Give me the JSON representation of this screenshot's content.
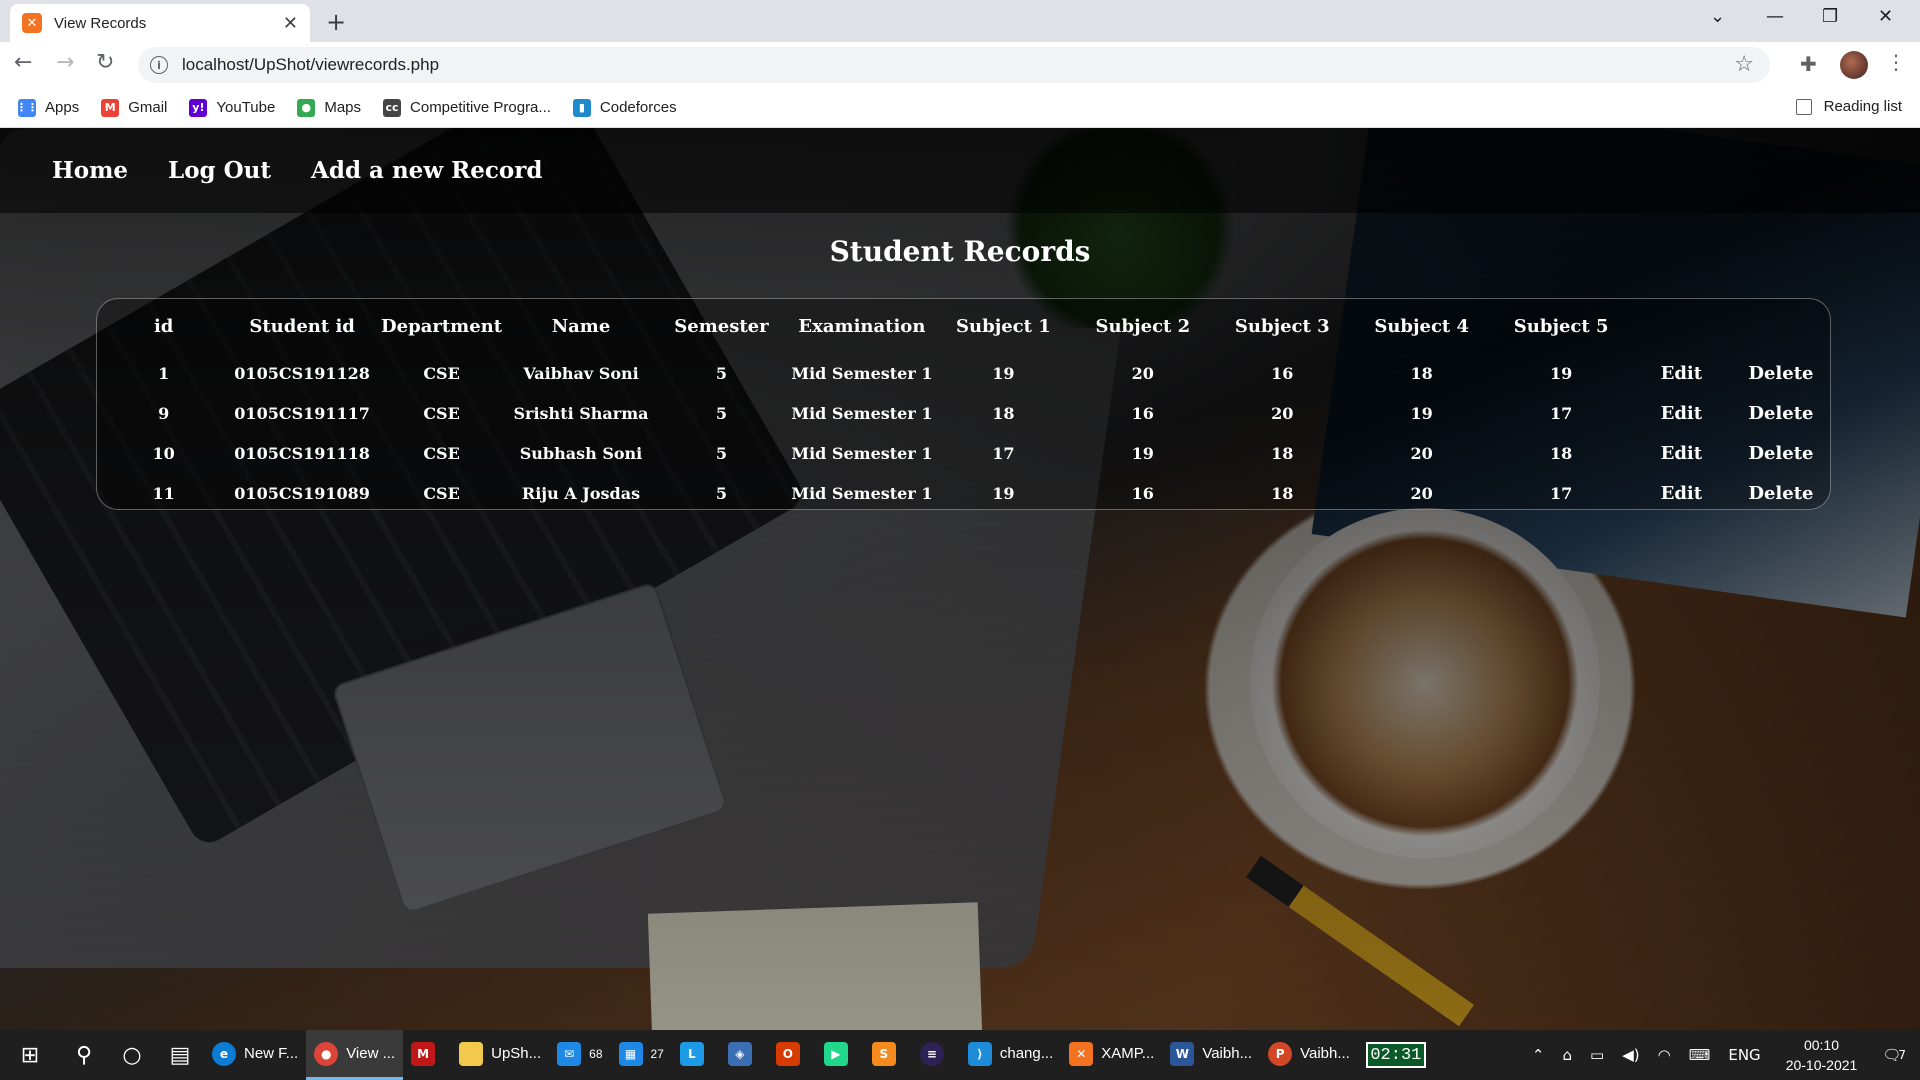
{
  "browser": {
    "tab_title": "View Records",
    "url": "localhost/UpShot/viewrecords.php",
    "bookmarks": [
      {
        "label": "Apps",
        "icon": "apps-grid-icon",
        "color": "#4285f4"
      },
      {
        "label": "Gmail",
        "icon": "gmail-icon",
        "color": "#ea4335"
      },
      {
        "label": "YouTube",
        "icon": "yahoo-icon",
        "color": "#6001d2"
      },
      {
        "label": "Maps",
        "icon": "maps-pin-icon",
        "color": "#34a853"
      },
      {
        "label": "Competitive Progra...",
        "icon": "cc-icon",
        "color": "#444444"
      },
      {
        "label": "Codeforces",
        "icon": "codeforces-icon",
        "color": "#1f8acb"
      }
    ],
    "reading_list": "Reading list"
  },
  "nav": {
    "home": "Home",
    "logout": "Log Out",
    "add": "Add a new Record"
  },
  "title": "Student Records",
  "table": {
    "headers": [
      "id",
      "Student id",
      "Department",
      "Name",
      "Semester",
      "Examination",
      "Subject 1",
      "Subject 2",
      "Subject 3",
      "Subject 4",
      "Subject 5",
      "",
      ""
    ],
    "edit_label": "Edit",
    "delete_label": "Delete",
    "rows": [
      [
        "1",
        "0105CS191128",
        "CSE",
        "Vaibhav Soni",
        "5",
        "Mid Semester 1",
        "19",
        "20",
        "16",
        "18",
        "19"
      ],
      [
        "9",
        "0105CS191117",
        "CSE",
        "Srishti Sharma",
        "5",
        "Mid Semester 1",
        "18",
        "16",
        "20",
        "19",
        "17"
      ],
      [
        "10",
        "0105CS191118",
        "CSE",
        "Subhash Soni",
        "5",
        "Mid Semester 1",
        "17",
        "19",
        "18",
        "20",
        "18"
      ],
      [
        "11",
        "0105CS191089",
        "CSE",
        "Riju A Josdas",
        "5",
        "Mid Semester 1",
        "19",
        "16",
        "18",
        "20",
        "17"
      ]
    ]
  },
  "taskbar": {
    "apps": [
      {
        "label": "New F...",
        "icon": "edge-icon",
        "color": "#0c7cd5",
        "active": false
      },
      {
        "label": "View ...",
        "icon": "chrome-icon",
        "color": "#db4437",
        "active": true
      },
      {
        "label": "",
        "icon": "mcafee-icon",
        "color": "#c01818",
        "active": false
      },
      {
        "label": "UpSh...",
        "icon": "folder-icon",
        "color": "#f2c94c",
        "active": false
      },
      {
        "label": "",
        "icon": "mail-icon",
        "color": "#1e88e5",
        "active": false,
        "badge": "68"
      },
      {
        "label": "",
        "icon": "calendar-icon",
        "color": "#1e88e5",
        "active": false,
        "badge": "27"
      },
      {
        "label": "",
        "icon": "l-app-icon",
        "color": "#1e9be6",
        "active": false
      },
      {
        "label": "",
        "icon": "virtualbox-icon",
        "color": "#3c6eb4",
        "active": false
      },
      {
        "label": "",
        "icon": "office-icon",
        "color": "#d83b01",
        "active": false
      },
      {
        "label": "",
        "icon": "pycharm-icon",
        "color": "#21d789",
        "active": false
      },
      {
        "label": "",
        "icon": "sublime-icon",
        "color": "#f58b1f",
        "active": false
      },
      {
        "label": "",
        "icon": "eclipse-icon",
        "color": "#2c2255",
        "active": false
      },
      {
        "label": "chang...",
        "icon": "vscode-icon",
        "color": "#1e8bd8",
        "active": false
      },
      {
        "label": "XAMP...",
        "icon": "xampp-icon",
        "color": "#f47321",
        "active": false
      },
      {
        "label": "Vaibh...",
        "icon": "word-icon",
        "color": "#2b579a",
        "active": false
      },
      {
        "label": "Vaibh...",
        "icon": "powerpoint-icon",
        "color": "#d24726",
        "active": false
      }
    ],
    "timer": "02:31",
    "lang": "ENG",
    "time": "00:10",
    "date": "20-10-2021",
    "notifications": "7"
  }
}
